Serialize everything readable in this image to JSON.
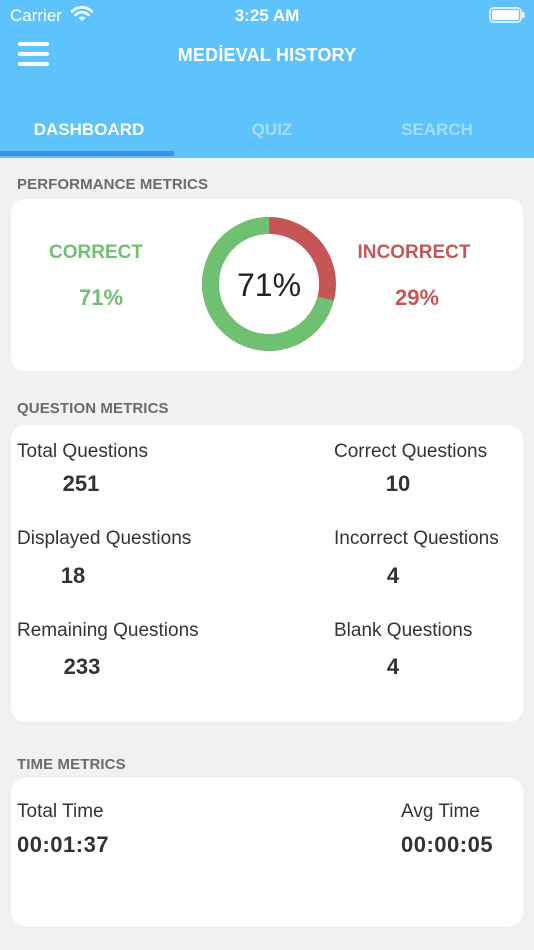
{
  "status_bar": {
    "carrier": "Carrier",
    "time": "3:25 AM"
  },
  "header": {
    "title": "MEDİEVAL HISTORY"
  },
  "tabs": [
    {
      "label": "DASHBOARD",
      "active": true
    },
    {
      "label": "QUIZ",
      "active": false
    },
    {
      "label": "SEARCH",
      "active": false
    }
  ],
  "performance": {
    "section_title": "PERFORMANCE METRICS",
    "correct_label": "CORRECT",
    "correct_value": "71%",
    "incorrect_label": "INCORRECT",
    "incorrect_value": "29%",
    "donut_center": "71%",
    "correct_fraction": 0.71
  },
  "questions": {
    "section_title": "QUESTION METRICS",
    "items": [
      {
        "label": "Total Questions",
        "value": "251"
      },
      {
        "label": "Correct Questions",
        "value": "10"
      },
      {
        "label": "Displayed Questions",
        "value": "18"
      },
      {
        "label": "Incorrect Questions",
        "value": "4"
      },
      {
        "label": "Remaining Questions",
        "value": "233"
      },
      {
        "label": "Blank Questions",
        "value": "4"
      }
    ]
  },
  "time": {
    "section_title": "TIME METRICS",
    "total_label": "Total Time",
    "total_value": "00:01:37",
    "avg_label": "Avg Time",
    "avg_value": "00:00:05"
  },
  "colors": {
    "header": "#5ec2fb",
    "correct": "#70c071",
    "incorrect": "#c65656",
    "tab_indicator": "#3f8ee6"
  },
  "icons": {
    "menu": "hamburger-menu-icon",
    "wifi": "wifi-icon",
    "battery": "battery-icon"
  }
}
